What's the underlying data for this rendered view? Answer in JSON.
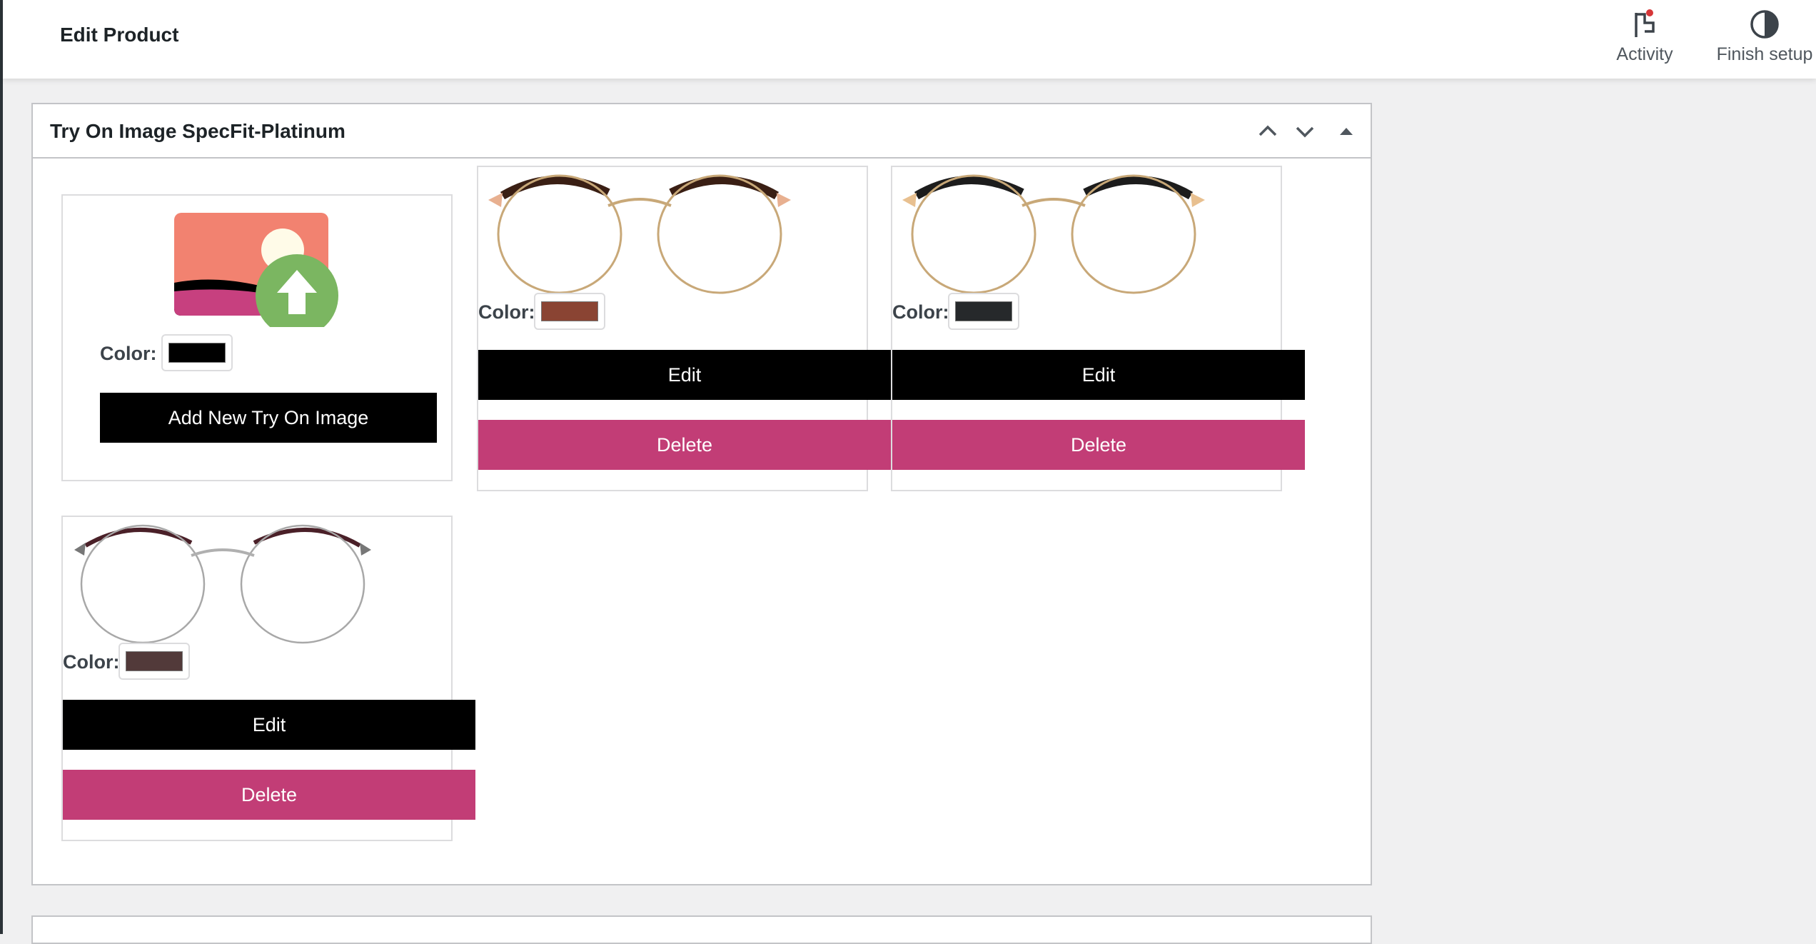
{
  "header": {
    "page_title": "Edit Product",
    "activity_label": "Activity",
    "finish_setup_label": "Finish setup",
    "icons": {
      "activity": "flag-icon",
      "finish_setup": "half-circle-icon"
    }
  },
  "panel": {
    "title": "Try On Image SpecFit-Platinum",
    "controls": [
      "chevron-up-icon",
      "chevron-down-icon",
      "triangle-up-icon"
    ]
  },
  "new_item": {
    "color_label": "Color:",
    "color_value": "#000000",
    "add_button_label": "Add New Try On Image",
    "icon": "image-upload-icon"
  },
  "items": [
    {
      "color_label": "Color:",
      "color_value": "#8a4433",
      "edit_label": "Edit",
      "delete_label": "Delete",
      "frame_color": "#3a1f14"
    },
    {
      "color_label": "Color:",
      "color_value": "#26292b",
      "edit_label": "Edit",
      "delete_label": "Delete",
      "frame_color": "#1c1c1c"
    },
    {
      "color_label": "Color:",
      "color_value": "#523a3a",
      "edit_label": "Edit",
      "delete_label": "Delete",
      "frame_color": "#4a2028"
    }
  ],
  "colors": {
    "edit_button": "#000000",
    "delete_button": "#c23d76",
    "notification_dot": "#d63638"
  }
}
